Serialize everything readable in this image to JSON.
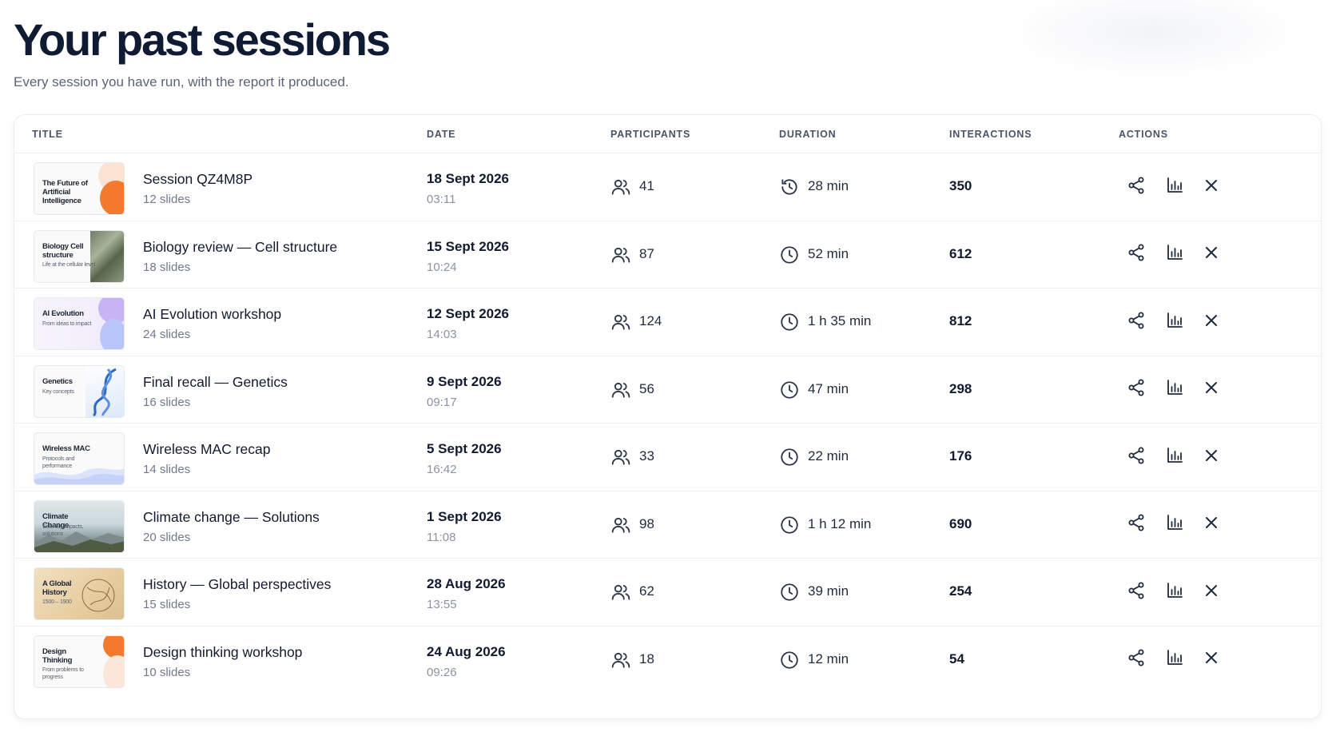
{
  "header": {
    "title": "Your past sessions",
    "subtitle": "Every session you have run, with the report it produced."
  },
  "table": {
    "columns": {
      "title": "TITLE",
      "date": "DATE",
      "participants": "PARTICIPANTS",
      "duration": "DURATION",
      "interactions": "INTERACTIONS",
      "actions": "ACTIONS"
    },
    "rows": [
      {
        "thumb_title": "The Future of Artificial Intelligence",
        "thumb_subtitle": "",
        "thumb_style": "ai-orange",
        "title": "Session QZ4M8P",
        "slides": "12 slides",
        "date": "18 Sept 2026",
        "time": "03:11",
        "participants": "41",
        "duration": "28 min",
        "interactions": "350",
        "duration_icon": "history-icon"
      },
      {
        "thumb_title": "Biology Cell structure",
        "thumb_subtitle": "Life at the cellular level",
        "thumb_style": "leaf",
        "title": "Biology review — Cell structure",
        "slides": "18 slides",
        "date": "15 Sept 2026",
        "time": "10:24",
        "participants": "87",
        "duration": "52 min",
        "interactions": "612",
        "duration_icon": "clock-icon"
      },
      {
        "thumb_title": "AI Evolution",
        "thumb_subtitle": "From ideas to impact",
        "thumb_style": "purple",
        "title": "AI Evolution workshop",
        "slides": "24 slides",
        "date": "12 Sept 2026",
        "time": "14:03",
        "participants": "124",
        "duration": "1 h 35 min",
        "interactions": "812",
        "duration_icon": "clock-icon"
      },
      {
        "thumb_title": "Genetics",
        "thumb_subtitle": "Key concepts",
        "thumb_style": "dna",
        "title": "Final recall — Genetics",
        "slides": "16 slides",
        "date": "9 Sept 2026",
        "time": "09:17",
        "participants": "56",
        "duration": "47 min",
        "interactions": "298",
        "duration_icon": "clock-icon"
      },
      {
        "thumb_title": "Wireless MAC",
        "thumb_subtitle": "Protocols and performance",
        "thumb_style": "wave",
        "title": "Wireless MAC recap",
        "slides": "14 slides",
        "date": "5 Sept 2026",
        "time": "16:42",
        "participants": "33",
        "duration": "22 min",
        "interactions": "176",
        "duration_icon": "clock-icon"
      },
      {
        "thumb_title": "Climate Change",
        "thumb_subtitle": "Science, impacts, solutions",
        "thumb_style": "mountains",
        "title": "Climate change — Solutions",
        "slides": "20 slides",
        "date": "1 Sept 2026",
        "time": "11:08",
        "participants": "98",
        "duration": "1 h 12 min",
        "interactions": "690",
        "duration_icon": "clock-icon"
      },
      {
        "thumb_title": "A Global History",
        "thumb_subtitle": "1500 – 1900",
        "thumb_style": "parchment",
        "title": "History — Global perspectives",
        "slides": "15 slides",
        "date": "28 Aug 2026",
        "time": "13:55",
        "participants": "62",
        "duration": "39 min",
        "interactions": "254",
        "duration_icon": "clock-icon"
      },
      {
        "thumb_title": "Design Thinking",
        "thumb_subtitle": "From problems to progress",
        "thumb_style": "design-orange",
        "title": "Design thinking workshop",
        "slides": "10 slides",
        "date": "24 Aug 2026",
        "time": "09:26",
        "participants": "18",
        "duration": "12 min",
        "interactions": "54",
        "duration_icon": "clock-icon"
      }
    ]
  },
  "icons": {
    "participants": "users-icon",
    "share": "share-icon",
    "report": "bar-chart-icon",
    "delete": "close-icon"
  },
  "colors": {
    "title": "#0f1a33",
    "text": "#111a2e",
    "muted": "#707a8c",
    "border": "#eceff3",
    "accent_orange": "#f37a2d"
  }
}
